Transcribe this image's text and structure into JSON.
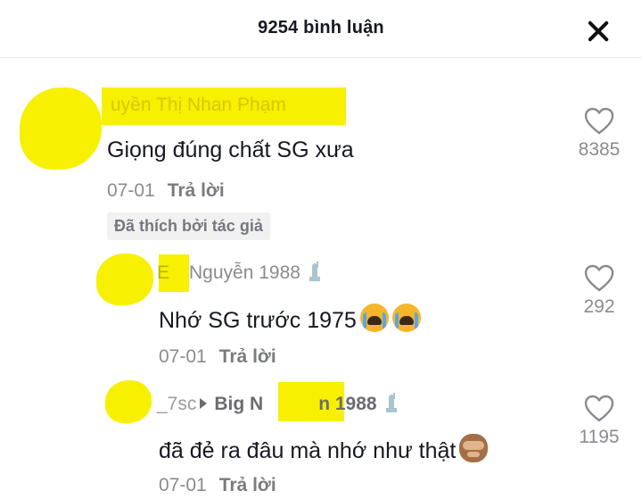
{
  "header": {
    "title": "9254 bình luận",
    "close_icon": "close-icon"
  },
  "comments": [
    {
      "username": "uyền Thị Nhan Phạm",
      "text": "Giọng đúng chất SG xưa",
      "date": "07-01",
      "reply_label": "Trả lời",
      "badge": "Đã thích bởi tác giả",
      "likes": "8385"
    },
    {
      "username_prefix": "E",
      "username": "Nguyễn 1988",
      "text": "Nhớ SG trước 1975",
      "date": "07-01",
      "reply_label": "Trả lời",
      "likes": "292"
    },
    {
      "username_prefix": "_7sc",
      "reply_to_prefix": "Big N",
      "reply_to_suffix": "n 1988",
      "text": "đã đẻ ra đâu mà nhớ như thật",
      "date": "07-01",
      "reply_label": "Trả lời",
      "likes": "1195"
    }
  ],
  "colors": {
    "highlight": "#f7f000",
    "muted_text": "#8a8b91",
    "primary_text": "#161823"
  }
}
